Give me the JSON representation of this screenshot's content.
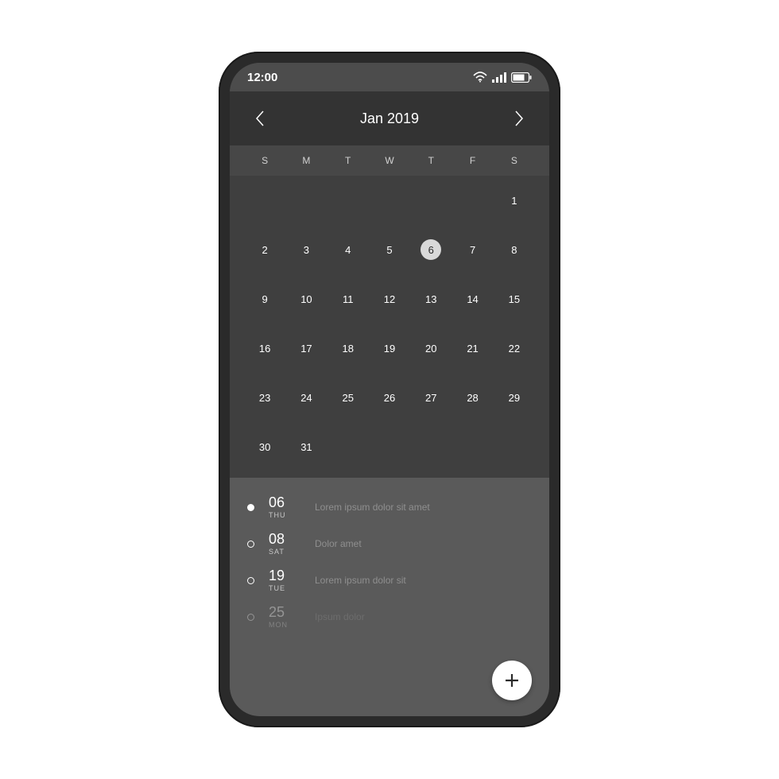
{
  "status": {
    "time": "12:00"
  },
  "header": {
    "month_label": "Jan 2019"
  },
  "weekdays": [
    "S",
    "M",
    "T",
    "W",
    "T",
    "F",
    "S"
  ],
  "calendar": {
    "selected": 6,
    "weeks": [
      [
        "",
        "",
        "",
        "",
        "",
        "",
        "1"
      ],
      [
        "2",
        "3",
        "4",
        "5",
        "6",
        "7",
        "8"
      ],
      [
        "9",
        "10",
        "11",
        "12",
        "13",
        "14",
        "15"
      ],
      [
        "16",
        "17",
        "18",
        "19",
        "20",
        "21",
        "22"
      ],
      [
        "23",
        "24",
        "25",
        "26",
        "27",
        "28",
        "29"
      ],
      [
        "30",
        "31",
        "",
        "",
        "",
        "",
        ""
      ]
    ]
  },
  "events": [
    {
      "date": "06",
      "dow": "THU",
      "text": "Lorem ipsum dolor sit amet",
      "filled": true,
      "faded": false
    },
    {
      "date": "08",
      "dow": "SAT",
      "text": "Dolor amet",
      "filled": false,
      "faded": false
    },
    {
      "date": "19",
      "dow": "TUE",
      "text": "Lorem ipsum dolor sit",
      "filled": false,
      "faded": false
    },
    {
      "date": "25",
      "dow": "MON",
      "text": "Ipsum dolor",
      "filled": false,
      "faded": true
    }
  ]
}
